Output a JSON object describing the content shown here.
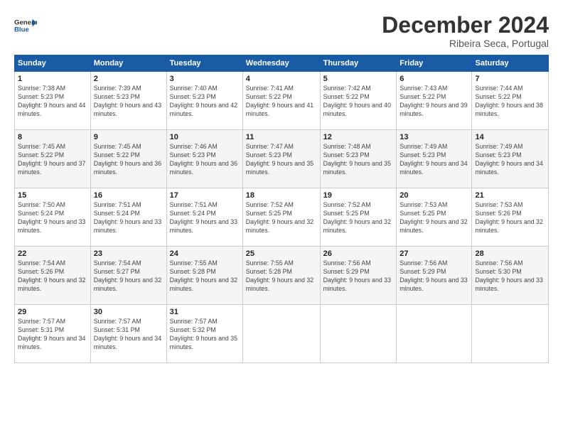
{
  "header": {
    "logo_line1": "General",
    "logo_line2": "Blue",
    "month_title": "December 2024",
    "location": "Ribeira Seca, Portugal"
  },
  "weekdays": [
    "Sunday",
    "Monday",
    "Tuesday",
    "Wednesday",
    "Thursday",
    "Friday",
    "Saturday"
  ],
  "weeks": [
    [
      {
        "day": "1",
        "sunrise": "7:38 AM",
        "sunset": "5:23 PM",
        "daylight": "9 hours and 44 minutes."
      },
      {
        "day": "2",
        "sunrise": "7:39 AM",
        "sunset": "5:23 PM",
        "daylight": "9 hours and 43 minutes."
      },
      {
        "day": "3",
        "sunrise": "7:40 AM",
        "sunset": "5:23 PM",
        "daylight": "9 hours and 42 minutes."
      },
      {
        "day": "4",
        "sunrise": "7:41 AM",
        "sunset": "5:22 PM",
        "daylight": "9 hours and 41 minutes."
      },
      {
        "day": "5",
        "sunrise": "7:42 AM",
        "sunset": "5:22 PM",
        "daylight": "9 hours and 40 minutes."
      },
      {
        "day": "6",
        "sunrise": "7:43 AM",
        "sunset": "5:22 PM",
        "daylight": "9 hours and 39 minutes."
      },
      {
        "day": "7",
        "sunrise": "7:44 AM",
        "sunset": "5:22 PM",
        "daylight": "9 hours and 38 minutes."
      }
    ],
    [
      {
        "day": "8",
        "sunrise": "7:45 AM",
        "sunset": "5:22 PM",
        "daylight": "9 hours and 37 minutes."
      },
      {
        "day": "9",
        "sunrise": "7:45 AM",
        "sunset": "5:22 PM",
        "daylight": "9 hours and 36 minutes."
      },
      {
        "day": "10",
        "sunrise": "7:46 AM",
        "sunset": "5:23 PM",
        "daylight": "9 hours and 36 minutes."
      },
      {
        "day": "11",
        "sunrise": "7:47 AM",
        "sunset": "5:23 PM",
        "daylight": "9 hours and 35 minutes."
      },
      {
        "day": "12",
        "sunrise": "7:48 AM",
        "sunset": "5:23 PM",
        "daylight": "9 hours and 35 minutes."
      },
      {
        "day": "13",
        "sunrise": "7:49 AM",
        "sunset": "5:23 PM",
        "daylight": "9 hours and 34 minutes."
      },
      {
        "day": "14",
        "sunrise": "7:49 AM",
        "sunset": "5:23 PM",
        "daylight": "9 hours and 34 minutes."
      }
    ],
    [
      {
        "day": "15",
        "sunrise": "7:50 AM",
        "sunset": "5:24 PM",
        "daylight": "9 hours and 33 minutes."
      },
      {
        "day": "16",
        "sunrise": "7:51 AM",
        "sunset": "5:24 PM",
        "daylight": "9 hours and 33 minutes."
      },
      {
        "day": "17",
        "sunrise": "7:51 AM",
        "sunset": "5:24 PM",
        "daylight": "9 hours and 33 minutes."
      },
      {
        "day": "18",
        "sunrise": "7:52 AM",
        "sunset": "5:25 PM",
        "daylight": "9 hours and 32 minutes."
      },
      {
        "day": "19",
        "sunrise": "7:52 AM",
        "sunset": "5:25 PM",
        "daylight": "9 hours and 32 minutes."
      },
      {
        "day": "20",
        "sunrise": "7:53 AM",
        "sunset": "5:25 PM",
        "daylight": "9 hours and 32 minutes."
      },
      {
        "day": "21",
        "sunrise": "7:53 AM",
        "sunset": "5:26 PM",
        "daylight": "9 hours and 32 minutes."
      }
    ],
    [
      {
        "day": "22",
        "sunrise": "7:54 AM",
        "sunset": "5:26 PM",
        "daylight": "9 hours and 32 minutes."
      },
      {
        "day": "23",
        "sunrise": "7:54 AM",
        "sunset": "5:27 PM",
        "daylight": "9 hours and 32 minutes."
      },
      {
        "day": "24",
        "sunrise": "7:55 AM",
        "sunset": "5:28 PM",
        "daylight": "9 hours and 32 minutes."
      },
      {
        "day": "25",
        "sunrise": "7:55 AM",
        "sunset": "5:28 PM",
        "daylight": "9 hours and 32 minutes."
      },
      {
        "day": "26",
        "sunrise": "7:56 AM",
        "sunset": "5:29 PM",
        "daylight": "9 hours and 33 minutes."
      },
      {
        "day": "27",
        "sunrise": "7:56 AM",
        "sunset": "5:29 PM",
        "daylight": "9 hours and 33 minutes."
      },
      {
        "day": "28",
        "sunrise": "7:56 AM",
        "sunset": "5:30 PM",
        "daylight": "9 hours and 33 minutes."
      }
    ],
    [
      {
        "day": "29",
        "sunrise": "7:57 AM",
        "sunset": "5:31 PM",
        "daylight": "9 hours and 34 minutes."
      },
      {
        "day": "30",
        "sunrise": "7:57 AM",
        "sunset": "5:31 PM",
        "daylight": "9 hours and 34 minutes."
      },
      {
        "day": "31",
        "sunrise": "7:57 AM",
        "sunset": "5:32 PM",
        "daylight": "9 hours and 35 minutes."
      },
      null,
      null,
      null,
      null
    ]
  ],
  "labels": {
    "sunrise": "Sunrise:",
    "sunset": "Sunset:",
    "daylight": "Daylight:"
  }
}
